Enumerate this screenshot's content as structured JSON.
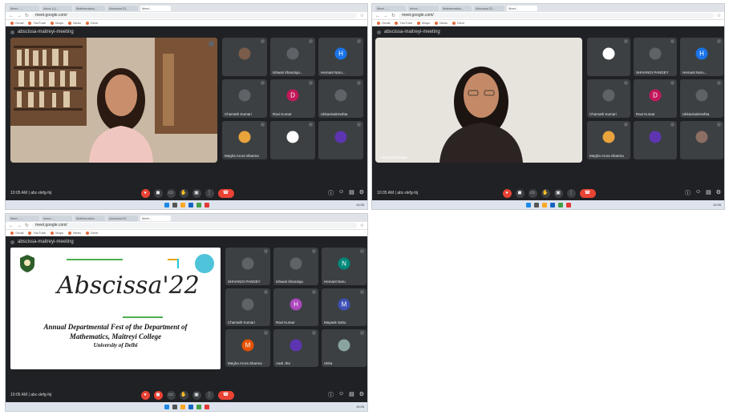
{
  "window1": {
    "tabs": [
      "Meet - ...",
      "Inbox (1) ...",
      "Mathematics...",
      "Abscissa'22...",
      "Meet..."
    ],
    "url": "meet.google.com/",
    "bookmarks": [
      "Gmail",
      "YouTube",
      "Maps",
      "News",
      "Drive"
    ],
    "meeting_title": "abscissa-maitreyi-meeting",
    "time": "10:05 AM",
    "meeting_code": "| abc-defg-hij",
    "participants": [
      {
        "name": "",
        "letter": "",
        "color": "#7a5c4a"
      },
      {
        "name": "Ishwari khanduja...",
        "letter": "",
        "color": "#5f6368"
      },
      {
        "name": "Hemant Naru...",
        "letter": "H",
        "color": "#1a73e8"
      },
      {
        "name": "Chamath Kumari",
        "letter": "",
        "color": "#5f6368"
      },
      {
        "name": "Ravi Kumar",
        "letter": "D",
        "color": "#c2185b"
      },
      {
        "name": "Ukkavinakmehta",
        "letter": "",
        "color": "#5f6368"
      },
      {
        "name": "Megha Arora Sharma",
        "letter": "",
        "color": "#e8a33c"
      },
      {
        "name": "",
        "letter": "",
        "color": "#ffffff"
      },
      {
        "name": "",
        "letter": "",
        "color": "#5e35b1"
      }
    ]
  },
  "window2": {
    "tabs": [
      "Meet - ...",
      "Inbox ...",
      "Mathematics...",
      "Abscissa'22...",
      "Meet..."
    ],
    "url": "meet.google.com/",
    "bookmarks": [
      "Gmail",
      "YouTube",
      "Maps",
      "News",
      "Drive"
    ],
    "meeting_title": "abscissa-maitreyi-meeting",
    "time": "10:05 AM",
    "meeting_code": "| abc-defg-hij",
    "self_name": "Aanchal Bhargav",
    "participants": [
      {
        "name": "",
        "letter": "",
        "color": "#ffffff"
      },
      {
        "name": "SHIVANGI PANDEY",
        "letter": "",
        "color": "#5f6368"
      },
      {
        "name": "Hemant Naru...",
        "letter": "H",
        "color": "#1a73e8"
      },
      {
        "name": "Chamath Kumari",
        "letter": "",
        "color": "#5f6368"
      },
      {
        "name": "Ravi Kumar",
        "letter": "D",
        "color": "#c2185b"
      },
      {
        "name": "Ukkavinakmehta",
        "letter": "",
        "color": "#5f6368"
      },
      {
        "name": "Megha Arora Sharma",
        "letter": "",
        "color": "#e8a33c"
      },
      {
        "name": "",
        "letter": "",
        "color": "#5e35b1"
      },
      {
        "name": "",
        "letter": "",
        "color": "#8d6e63"
      }
    ]
  },
  "window3": {
    "tabs": [
      "Meet - ...",
      "Inbox ...",
      "Mathematics...",
      "Abscissa'22...",
      "Meet..."
    ],
    "url": "meet.google.com/",
    "bookmarks": [
      "Gmail",
      "YouTube",
      "Maps",
      "News",
      "Drive"
    ],
    "meeting_title": "abscissa-maitreyi-meeting",
    "time": "10:05 AM",
    "meeting_code": "| abc-defg-hij",
    "slide": {
      "title": "Abscissa'22",
      "line1": "Annual Departmental Fest of the Department of",
      "line2": "Mathematics, Maitreyi College",
      "line3": "University of Delhi"
    },
    "participants": [
      {
        "name": "SHIVANGI PANDEY",
        "letter": "",
        "color": "#5f6368"
      },
      {
        "name": "Ishwari khanduja",
        "letter": "",
        "color": "#5f6368"
      },
      {
        "name": "Hemant Naru",
        "letter": "N",
        "color": "#00897b"
      },
      {
        "name": "Chamath Kumari",
        "letter": "",
        "color": "#5f6368"
      },
      {
        "name": "Ravi Kumar",
        "letter": "H",
        "color": "#ab47bc"
      },
      {
        "name": "Mayank Sahu",
        "letter": "M",
        "color": "#3f51b5"
      },
      {
        "name": "Megha Arora Sharma",
        "letter": "M",
        "color": "#e65100"
      },
      {
        "name": "Aarti Jha",
        "letter": "",
        "color": "#5e35b1"
      },
      {
        "name": "Ukka",
        "letter": "",
        "color": "#8aa3a0"
      }
    ]
  },
  "taskbar_clock": "10:05"
}
